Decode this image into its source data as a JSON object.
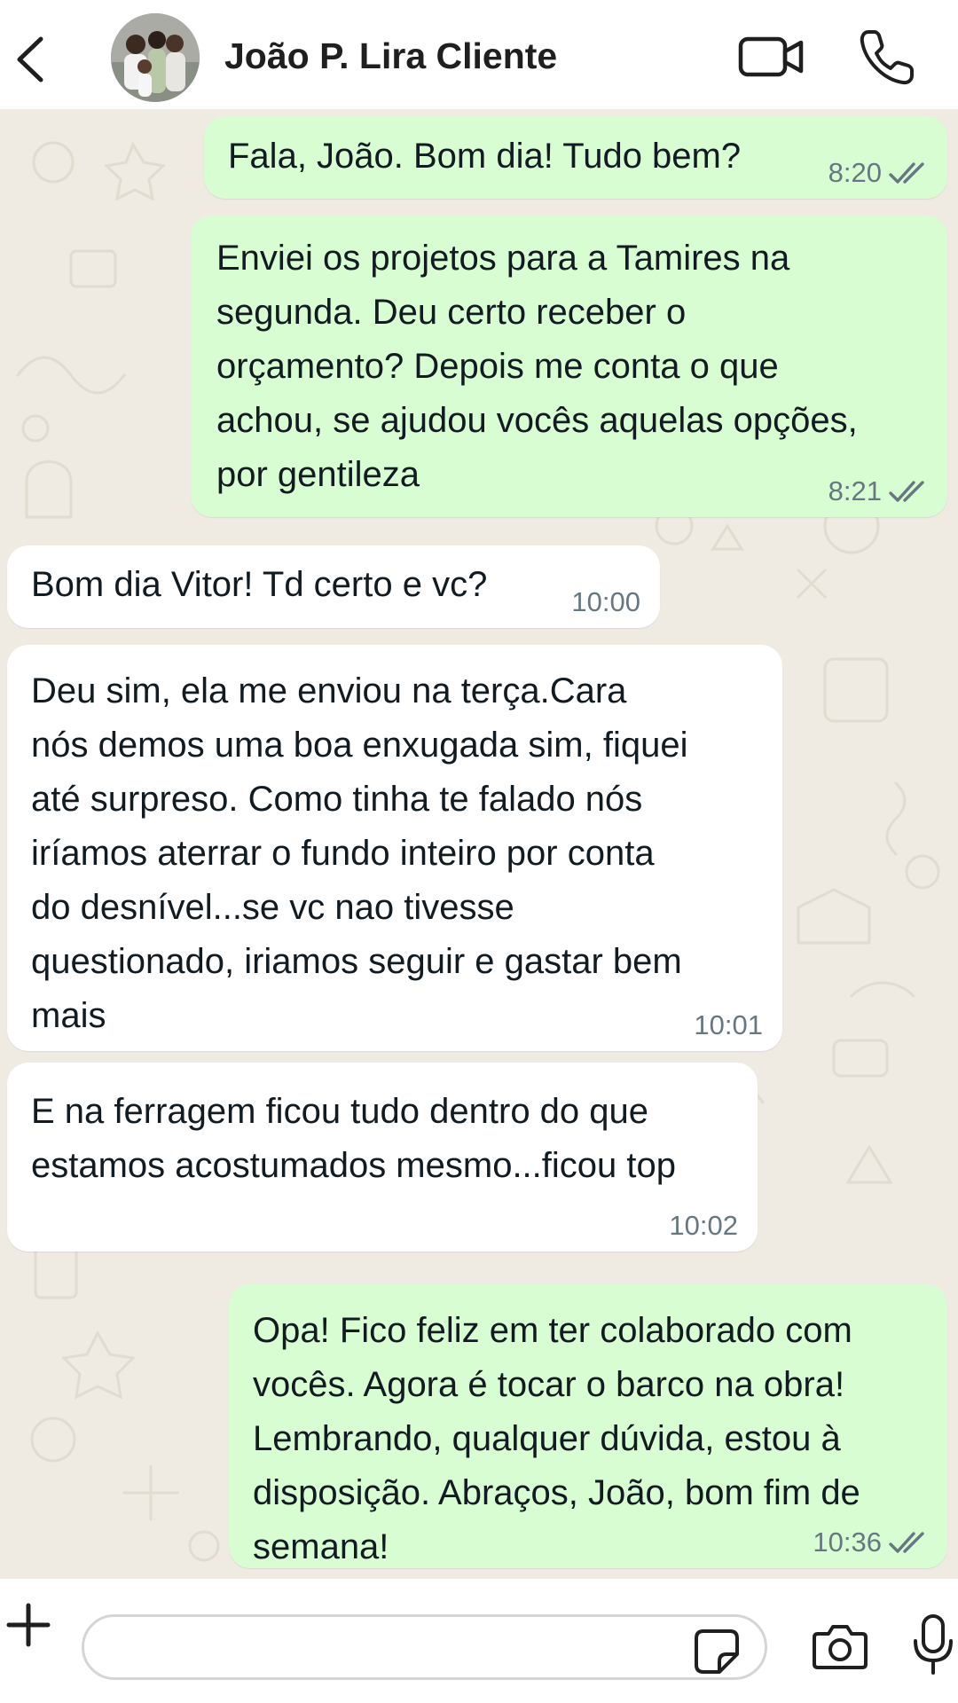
{
  "header": {
    "contact_name": "João P. Lira Cliente",
    "back_icon": "chevron-left-icon",
    "video_icon": "video-camera-icon",
    "call_icon": "phone-icon"
  },
  "messages": [
    {
      "direction": "outgoing",
      "text": "Fala, João. Bom dia! Tudo bem?",
      "time": "8:20",
      "status": "read"
    },
    {
      "direction": "outgoing",
      "text": "Enviei os projetos para a Tamires na\nsegunda. Deu certo receber o\norçamento? Depois me conta o que\nachou, se ajudou vocês aquelas opções,\npor gentileza",
      "time": "8:21",
      "status": "read"
    },
    {
      "direction": "incoming",
      "text": "Bom dia Vitor! Td certo e vc?",
      "time": "10:00"
    },
    {
      "direction": "incoming",
      "text": "Deu sim, ela me enviou na terça.Cara\nnós demos uma boa enxugada sim, fiquei\naté surpreso. Como tinha te falado nós\niríamos aterrar o fundo inteiro por conta\ndo desnível...se vc nao tivesse\nquestionado, iriamos seguir e gastar bem\nmais",
      "time": "10:01"
    },
    {
      "direction": "incoming",
      "text": "E na ferragem ficou tudo dentro do que\nestamos acostumados mesmo...ficou top",
      "time": "10:02"
    },
    {
      "direction": "outgoing",
      "text": "Opa! Fico feliz em ter colaborado com\nvocês. Agora é tocar o barco na obra!\nLembrando, qualquer dúvida, estou à\ndisposição. Abraços, João, bom fim de\nsemana!",
      "time": "10:36",
      "status": "read"
    }
  ],
  "input_bar": {
    "value": "",
    "plus_icon": "plus-icon",
    "sticker_icon": "sticker-icon",
    "camera_icon": "camera-icon",
    "mic_icon": "microphone-icon"
  },
  "colors": {
    "outgoing_bubble": "#d9fdd3",
    "incoming_bubble": "#ffffff",
    "chat_background": "#efeae2",
    "read_ticks": "#667781"
  }
}
